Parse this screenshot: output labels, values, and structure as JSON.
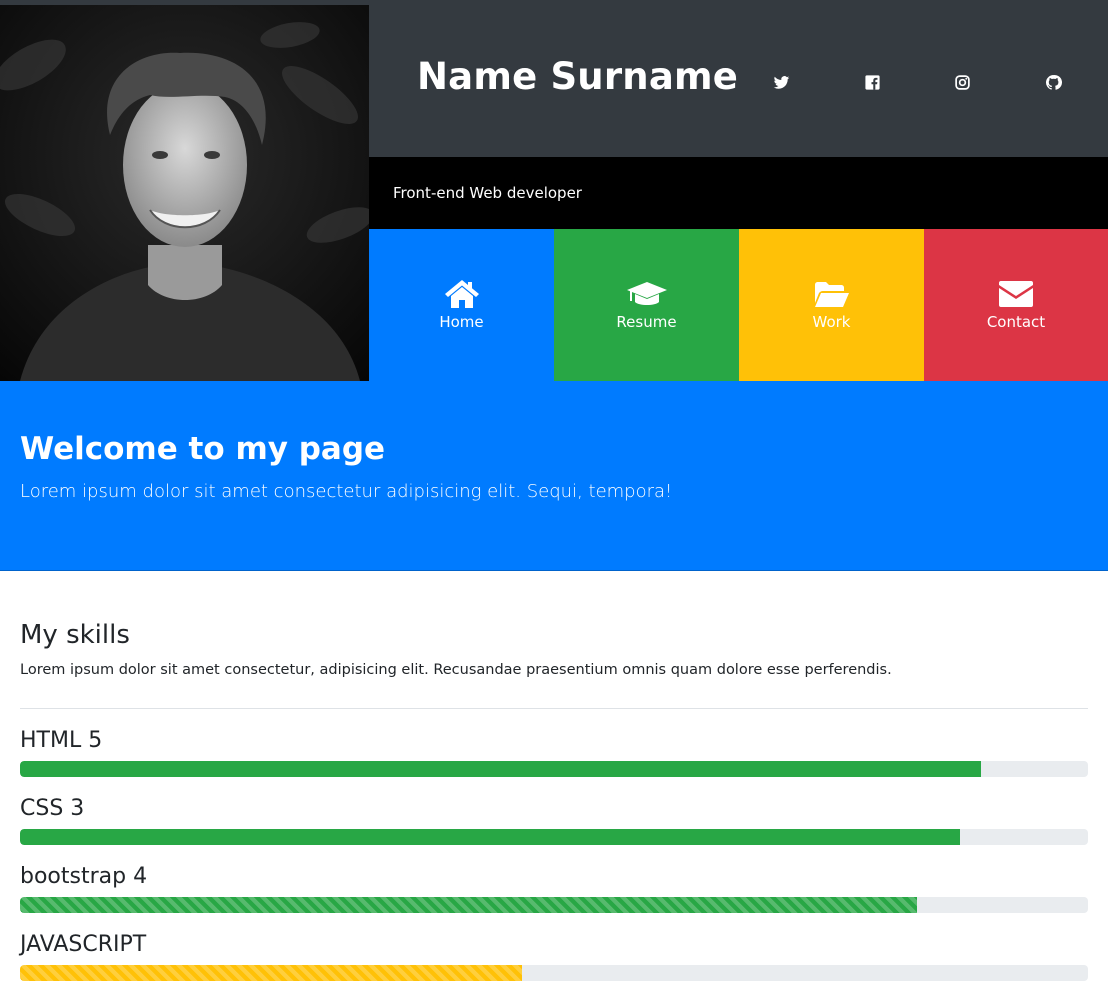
{
  "header": {
    "name": "Name Surname",
    "role": "Front-end Web developer",
    "social": [
      {
        "icon": "twitter-icon"
      },
      {
        "icon": "facebook-icon"
      },
      {
        "icon": "instagram-icon"
      },
      {
        "icon": "github-icon"
      }
    ]
  },
  "nav": [
    {
      "label": "Home",
      "icon": "home-icon",
      "color": "#007bff"
    },
    {
      "label": "Resume",
      "icon": "graduation-cap-icon",
      "color": "#28a745"
    },
    {
      "label": "Work",
      "icon": "folder-open-icon",
      "color": "#ffc107"
    },
    {
      "label": "Contact",
      "icon": "envelope-icon",
      "color": "#dc3545"
    }
  ],
  "welcome": {
    "title": "Welcome to my page",
    "text": "Lorem ipsum dolor sit amet consectetur adipisicing elit. Sequi, tempora!",
    "color": "#007bff"
  },
  "skills": {
    "title": "My skills",
    "intro": "Lorem ipsum dolor sit amet consectetur, adipisicing elit. Recusandae praesentium omnis quam dolore esse perferendis.",
    "items": [
      {
        "name": "HTML 5",
        "percent": 90,
        "color": "#28a745",
        "striped": false
      },
      {
        "name": "CSS 3",
        "percent": 88,
        "color": "#28a745",
        "striped": false
      },
      {
        "name": "bootstrap 4",
        "percent": 84,
        "color": "#28a745",
        "striped": true
      },
      {
        "name": "JAVASCRIPT",
        "percent": 47,
        "color": "#ffc107",
        "striped": true
      }
    ]
  }
}
